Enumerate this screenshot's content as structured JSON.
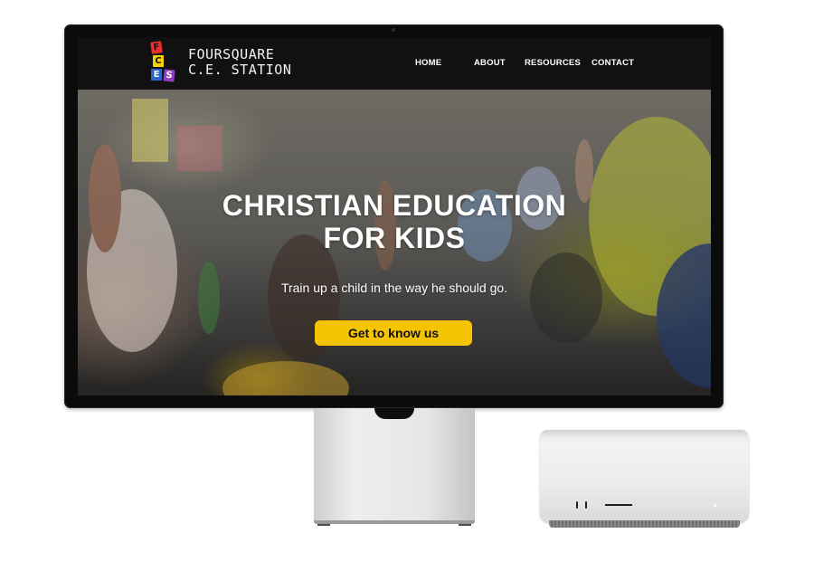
{
  "site": {
    "logo": {
      "blocks": [
        "F",
        "C",
        "E",
        "S"
      ],
      "line1": "FOURSQUARE",
      "line2": "C.E. STATION"
    },
    "nav": {
      "home": "HOME",
      "about": "ABOUT",
      "resources": "RESOURCES",
      "contact": "CONTACT"
    },
    "hero": {
      "title_line1": "CHRISTIAN EDUCATION",
      "title_line2": "FOR KIDS",
      "subtitle": "Train up a child in the way he should go.",
      "cta_label": "Get to know us"
    }
  },
  "colors": {
    "nav_background": "#111111",
    "cta_accent": "#f5c400",
    "logo_red": "#e8312f",
    "logo_yellow": "#f6d200",
    "logo_blue": "#2c62c9",
    "logo_purple": "#8e3fbf"
  },
  "devices": {
    "display": "studio-display-icon",
    "computer": "mac-studio-icon"
  }
}
